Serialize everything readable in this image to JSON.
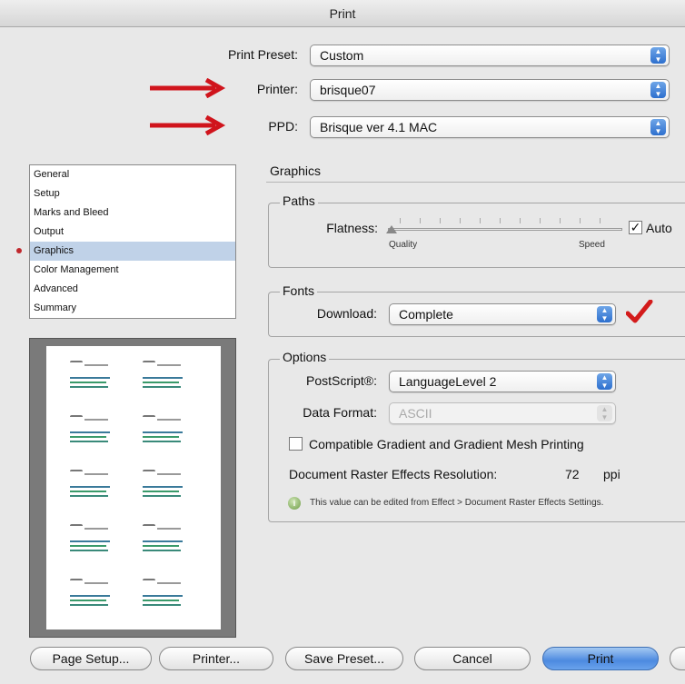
{
  "window": {
    "title": "Print"
  },
  "header": {
    "print_preset": {
      "label": "Print Preset:",
      "value": "Custom"
    },
    "printer": {
      "label": "Printer:",
      "value": "brisque07"
    },
    "ppd": {
      "label": "PPD:",
      "value": "Brisque ver 4.1 MAC"
    }
  },
  "sidebar": {
    "items": [
      {
        "label": "General"
      },
      {
        "label": "Setup"
      },
      {
        "label": "Marks and Bleed"
      },
      {
        "label": "Output"
      },
      {
        "label": "Graphics"
      },
      {
        "label": "Color Management"
      },
      {
        "label": "Advanced"
      },
      {
        "label": "Summary"
      }
    ],
    "selected_index": 4
  },
  "graphics": {
    "title": "Graphics",
    "paths": {
      "legend": "Paths",
      "flatness_label": "Flatness:",
      "quality_label": "Quality",
      "speed_label": "Speed",
      "auto_label": "Auto",
      "auto_checked": true
    },
    "fonts": {
      "legend": "Fonts",
      "download_label": "Download:",
      "download_value": "Complete"
    },
    "options": {
      "legend": "Options",
      "postscript_label": "PostScript®:",
      "postscript_value": "LanguageLevel 2",
      "data_format_label": "Data Format:",
      "data_format_value": "ASCII",
      "compat_label": "Compatible Gradient and Gradient Mesh Printing",
      "compat_checked": false,
      "raster_label": "Document Raster Effects Resolution:",
      "raster_value": "72",
      "raster_unit": "ppi",
      "info_text": "This value can be edited from Effect > Document Raster Effects Settings."
    }
  },
  "footer": {
    "page_setup": "Page Setup...",
    "printer": "Printer...",
    "save_preset": "Save Preset...",
    "cancel": "Cancel",
    "print": "Print"
  },
  "colors": {
    "annotation_red": "#d0141c",
    "checkmark_red": "#d31b1b",
    "selection": "#c0d2e8",
    "default_button": "#4d8ae0"
  }
}
